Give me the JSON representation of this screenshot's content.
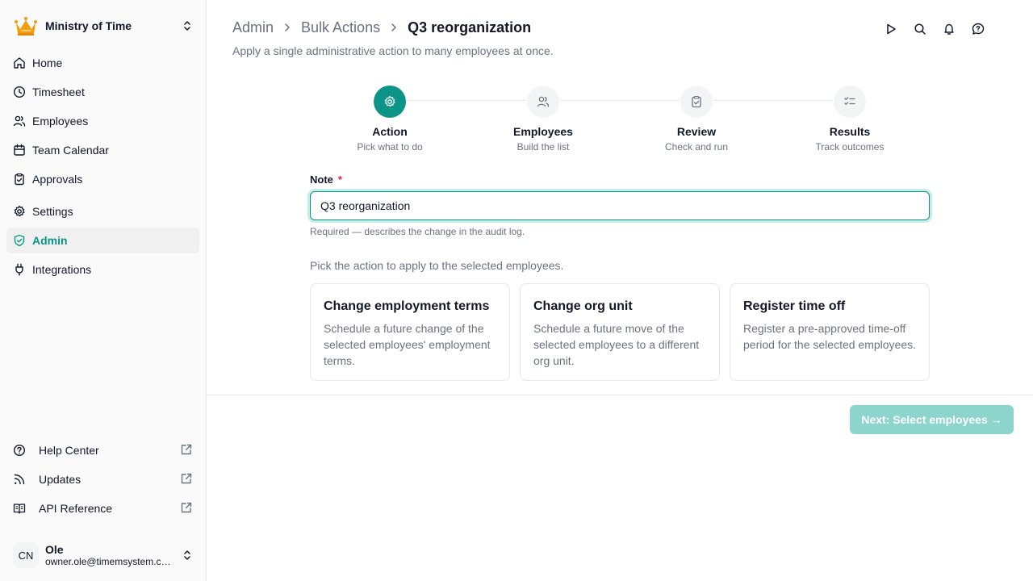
{
  "sidebar": {
    "org_name": "Ministry of Time",
    "nav": [
      {
        "label": "Home",
        "icon": "home-icon"
      },
      {
        "label": "Timesheet",
        "icon": "clock-icon"
      },
      {
        "label": "Employees",
        "icon": "users-icon"
      },
      {
        "label": "Team Calendar",
        "icon": "calendar-icon"
      },
      {
        "label": "Approvals",
        "icon": "clipboard-check-icon"
      },
      {
        "label": "Settings",
        "icon": "gear-icon"
      },
      {
        "label": "Admin",
        "icon": "shield-check-icon",
        "active": true
      },
      {
        "label": "Integrations",
        "icon": "plug-icon"
      }
    ],
    "footer_links": [
      {
        "label": "Help Center",
        "icon": "help-circle-icon"
      },
      {
        "label": "Updates",
        "icon": "rss-icon"
      },
      {
        "label": "API Reference",
        "icon": "book-icon"
      }
    ],
    "user": {
      "initials": "CN",
      "name": "Ole",
      "email": "owner.ole@timemsystem.com"
    }
  },
  "header": {
    "breadcrumb": [
      "Admin",
      "Bulk Actions",
      "Q3 reorganization"
    ],
    "subtitle": "Apply a single administrative action to many employees at once."
  },
  "steps": [
    {
      "name": "Action",
      "desc": "Pick what to do",
      "active": true
    },
    {
      "name": "Employees",
      "desc": "Build the list"
    },
    {
      "name": "Review",
      "desc": "Check and run"
    },
    {
      "name": "Results",
      "desc": "Track outcomes"
    }
  ],
  "form": {
    "note_label": "Note",
    "required_mark": "*",
    "note_value": "Q3 reorganization",
    "helper": "Required — describes the change in the audit log.",
    "pick_text": "Pick the action to apply to the selected employees."
  },
  "actions": [
    {
      "title": "Change employment terms",
      "desc": "Schedule a future change of the selected employees' employment terms."
    },
    {
      "title": "Change org unit",
      "desc": "Schedule a future move of the selected employees to a different org unit."
    },
    {
      "title": "Register time off",
      "desc": "Register a pre-approved time-off period for the selected employees."
    }
  ],
  "footer": {
    "next_label": "Next: Select employees →"
  },
  "colors": {
    "accent": "#0d9488",
    "disabled_button": "#8dd4cd",
    "logo": "#f59e0b"
  }
}
